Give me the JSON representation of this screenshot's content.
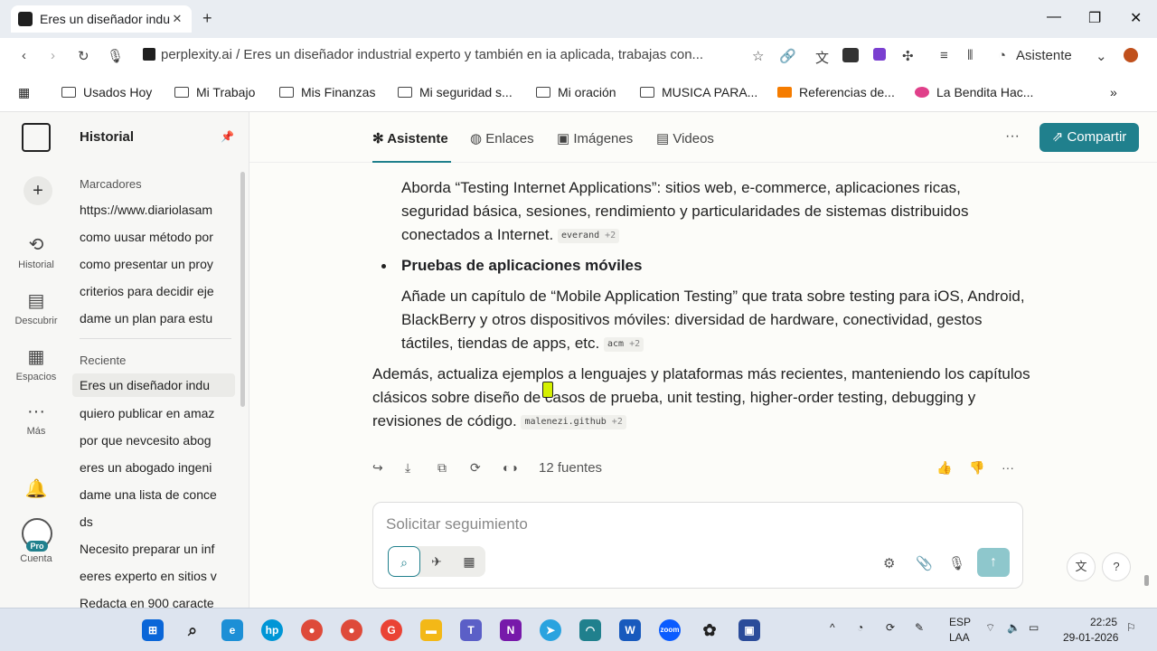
{
  "browser": {
    "tab_title": "Eres un diseñador industr",
    "url_text": "perplexity.ai / Eres un diseñador industrial experto y también en ia aplicada, trabajas con...",
    "assistant_label": "Asistente",
    "bookmarks": [
      "Usados Hoy",
      "Mi Trabajo",
      "Mis Finanzas",
      "Mi seguridad s...",
      "Mi oración",
      "MUSICA PARA...",
      "Referencias de...",
      "La Bendita Hac..."
    ]
  },
  "rail": {
    "items": [
      {
        "label": "Historial",
        "icon": "history-icon"
      },
      {
        "label": "Descubrir",
        "icon": "discover-icon"
      },
      {
        "label": "Espacios",
        "icon": "spaces-icon"
      },
      {
        "label": "Más",
        "icon": "more-icon"
      }
    ],
    "pro_badge": "Pro",
    "account_label": "Cuenta"
  },
  "panel": {
    "title": "Historial",
    "marcadores_header": "Marcadores",
    "marcadores": [
      "https://www.diariolasam",
      "como uusar método por",
      "como presentar un proy",
      "criterios para decidir eje",
      "dame un plan para estu"
    ],
    "reciente_header": "Reciente",
    "reciente": [
      "Eres un diseñador indu",
      "quiero publicar en amaz",
      "por que nevcesito abog",
      "eres un abogado ingeni",
      "dame una lista de conce",
      "ds",
      "Necesito preparar un inf",
      "eeres experto en sitios v",
      "Redacta en 900 caracte"
    ]
  },
  "main": {
    "tabs": [
      "Asistente",
      "Enlaces",
      "Imágenes",
      "Videos"
    ],
    "share_label": "Compartir",
    "para1_lines": [
      "Aborda “Testing Internet Applications”: sitios web, e-commerce, aplicaciones ricas,",
      "seguridad básica, sesiones, rendimiento y particularidades de sistemas distribuidos",
      "conectados a Internet."
    ],
    "cite1": {
      "source": "everand",
      "more": "+2"
    },
    "bullet_heading": "Pruebas de aplicaciones móviles",
    "para2_lines": [
      "Añade un capítulo de “Mobile Application Testing” que trata sobre testing para iOS, Android,",
      "BlackBerry y otros dispositivos móviles: diversidad de hardware, conectividad, gestos",
      "táctiles, tiendas de apps, etc."
    ],
    "cite2": {
      "source": "acm",
      "more": "+2"
    },
    "para3_lines": [
      "Además, actualiza ejemplos a lenguajes y plataformas más recientes, manteniendo los capítulos",
      "clásicos sobre diseño de casos de prueba, unit testing, higher-order testing, debugging y",
      "revisiones de código."
    ],
    "cite3": {
      "source": "malenezi.github",
      "more": "+2"
    },
    "sources_label": "12 fuentes",
    "input_placeholder": "Solicitar seguimiento"
  },
  "taskbar": {
    "lang_top": "ESP",
    "lang_bottom": "LAA",
    "time": "22:25",
    "date": "29-01-2026"
  },
  "colors": {
    "accent": "#20808d",
    "send_disabled": "#8ec7cc"
  }
}
